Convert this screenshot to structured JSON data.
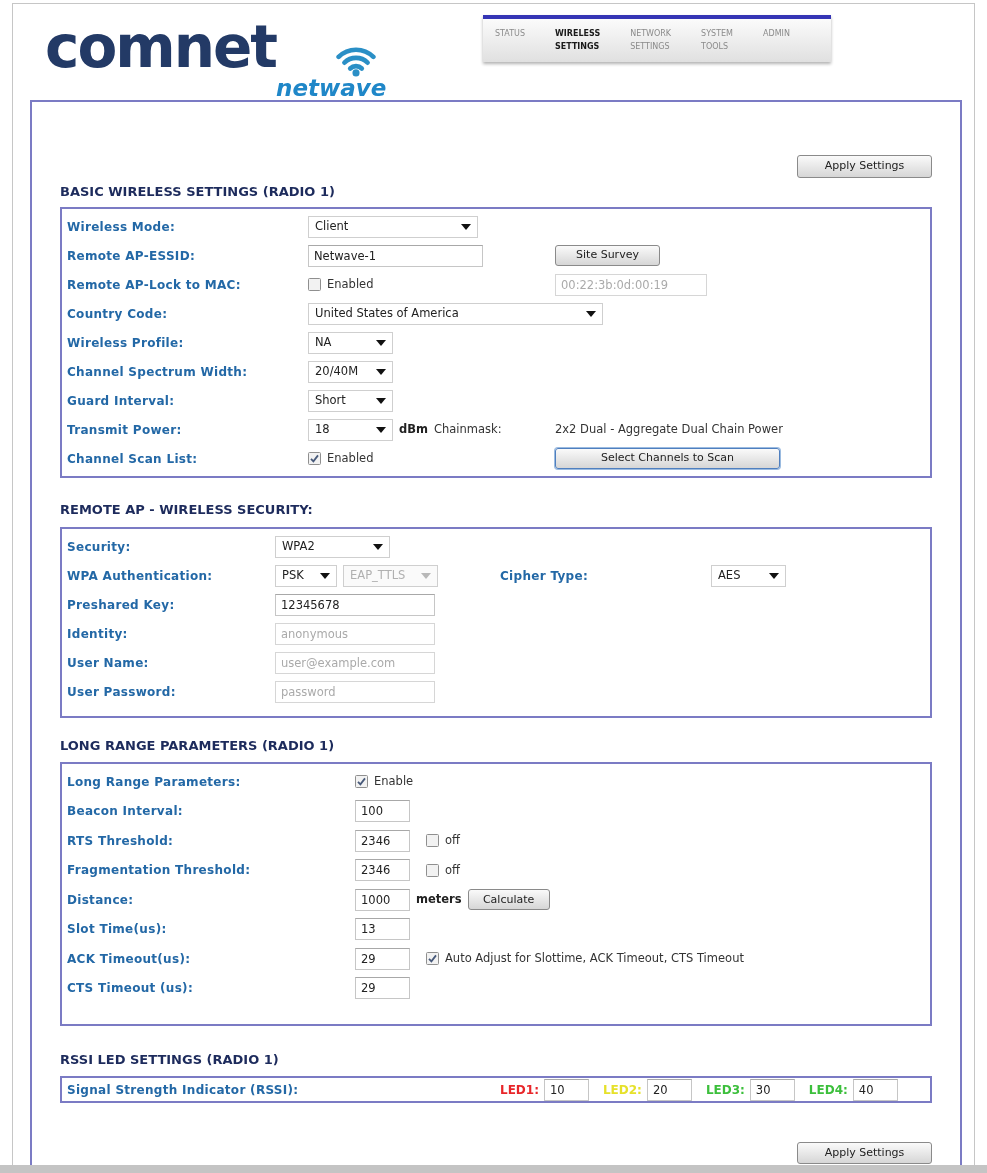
{
  "logo": {
    "brand": "comnet",
    "product": "netwave"
  },
  "nav_tabs": [
    {
      "label": "STATUS",
      "selected": false
    },
    {
      "label": "WIRELESS SETTINGS",
      "selected": true
    },
    {
      "label": "NETWORK SETTINGS",
      "selected": false
    },
    {
      "label": "SYSTEM TOOLS",
      "selected": false
    },
    {
      "label": "ADMIN",
      "selected": false
    }
  ],
  "apply_top": {
    "label": "Apply Settings"
  },
  "sections": [
    {
      "title": "BASIC WIRELESS SETTINGS (RADIO 1)",
      "rows": [
        {
          "label": "Wireless Mode:",
          "controls": [
            {
              "kind": "select",
              "value": "Client",
              "disabled": false
            }
          ]
        },
        {
          "label": "Remote AP-ESSID:",
          "controls": [
            {
              "kind": "input",
              "value": "Netwave-1",
              "disabled": false
            }
          ],
          "side": [
            {
              "kind": "button",
              "label": "Site Survey",
              "focused": false
            }
          ]
        },
        {
          "label": "Remote AP-Lock to MAC:",
          "controls": [
            {
              "kind": "checkbox",
              "label": "Enabled",
              "checked": false
            }
          ],
          "side": [
            {
              "kind": "input",
              "value": "00:22:3b:0d:00:19",
              "disabled": true
            }
          ]
        },
        {
          "label": "Country Code:",
          "controls": [
            {
              "kind": "select",
              "value": "United States of America",
              "disabled": false
            }
          ]
        },
        {
          "label": "Wireless Profile:",
          "controls": [
            {
              "kind": "select",
              "value": "NA",
              "disabled": false
            }
          ]
        },
        {
          "label": "Channel Spectrum Width:",
          "controls": [
            {
              "kind": "select",
              "value": "20/40M",
              "disabled": false
            }
          ]
        },
        {
          "label": "Guard Interval:",
          "controls": [
            {
              "kind": "select",
              "value": "Short",
              "disabled": false
            }
          ]
        },
        {
          "label": "Transmit Power:",
          "controls": [
            {
              "kind": "select",
              "value": "18",
              "disabled": false
            },
            {
              "kind": "unit",
              "text": "dBm"
            },
            {
              "kind": "note",
              "text": "Chainmask:"
            }
          ],
          "side": [
            {
              "kind": "note",
              "text": "2x2 Dual - Aggregate Dual Chain Power"
            }
          ]
        },
        {
          "label": "Channel Scan List:",
          "controls": [
            {
              "kind": "checkbox",
              "label": "Enabled",
              "checked": true
            }
          ],
          "side": [
            {
              "kind": "button",
              "label": "Select Channels to Scan",
              "focused": true
            }
          ]
        }
      ]
    },
    {
      "title": "REMOTE AP - WIRELESS SECURITY:",
      "rows": [
        {
          "label": "Security:",
          "controls": [
            {
              "kind": "select",
              "value": "WPA2",
              "disabled": false
            }
          ]
        },
        {
          "label": "WPA Authentication:",
          "controls": [
            {
              "kind": "select",
              "value": "PSK",
              "disabled": false
            },
            {
              "kind": "select",
              "value": "EAP_TTLS",
              "disabled": true
            }
          ],
          "side": [
            {
              "kind": "label",
              "text": "Cipher Type:"
            },
            {
              "kind": "select",
              "value": "AES",
              "disabled": false
            }
          ]
        },
        {
          "label": "Preshared Key:",
          "controls": [
            {
              "kind": "input",
              "value": "12345678",
              "disabled": false
            }
          ]
        },
        {
          "label": "Identity:",
          "controls": [
            {
              "kind": "input",
              "placeholder": "anonymous",
              "disabled": true
            }
          ]
        },
        {
          "label": "User Name:",
          "controls": [
            {
              "kind": "input",
              "placeholder": "user@example.com",
              "disabled": true
            }
          ]
        },
        {
          "label": "User Password:",
          "controls": [
            {
              "kind": "input",
              "placeholder": "password",
              "disabled": true
            }
          ]
        }
      ]
    },
    {
      "title": "LONG RANGE PARAMETERS (RADIO 1)",
      "rows": [
        {
          "label": "Long Range Parameters:",
          "controls": [
            {
              "kind": "checkbox",
              "label": "Enable",
              "checked": true
            }
          ]
        },
        {
          "label": "Beacon Interval:",
          "controls": [
            {
              "kind": "input",
              "value": "100",
              "disabled": false
            }
          ]
        },
        {
          "label": "RTS Threshold:",
          "controls": [
            {
              "kind": "input",
              "value": "2346",
              "disabled": false
            },
            {
              "kind": "checkbox",
              "label": "off",
              "checked": false
            }
          ]
        },
        {
          "label": "Fragmentation Threshold:",
          "controls": [
            {
              "kind": "input",
              "value": "2346",
              "disabled": false
            },
            {
              "kind": "checkbox",
              "label": "off",
              "checked": false
            }
          ]
        },
        {
          "label": "Distance:",
          "controls": [
            {
              "kind": "input",
              "value": "1000",
              "disabled": false
            },
            {
              "kind": "unit",
              "text": "meters"
            },
            {
              "kind": "button",
              "label": "Calculate",
              "focused": false
            }
          ]
        },
        {
          "label": "Slot Time(us):",
          "controls": [
            {
              "kind": "input",
              "value": "13",
              "disabled": false
            }
          ]
        },
        {
          "label": "ACK Timeout(us):",
          "controls": [
            {
              "kind": "input",
              "value": "29",
              "disabled": false
            },
            {
              "kind": "checkbox",
              "label": "Auto Adjust for Slottime, ACK Timeout, CTS Timeout",
              "checked": true
            }
          ]
        },
        {
          "label": "CTS Timeout (us):",
          "controls": [
            {
              "kind": "input",
              "value": "29",
              "disabled": false
            }
          ]
        }
      ]
    },
    {
      "title": "RSSI LED SETTINGS (RADIO 1)",
      "rows": [
        {
          "label": "Signal Strength Indicator (RSSI):",
          "controls": [
            {
              "kind": "led",
              "label": "LED1:",
              "color": "#e8262a",
              "value": "10"
            },
            {
              "kind": "led",
              "label": "LED2:",
              "color": "#e6e12a",
              "value": "20"
            },
            {
              "kind": "led",
              "label": "LED3:",
              "color": "#3cbf3c",
              "value": "30"
            },
            {
              "kind": "led",
              "label": "LED4:",
              "color": "#3cbf3c",
              "value": "40"
            }
          ]
        }
      ]
    }
  ],
  "apply_bottom": {
    "label": "Apply Settings"
  }
}
